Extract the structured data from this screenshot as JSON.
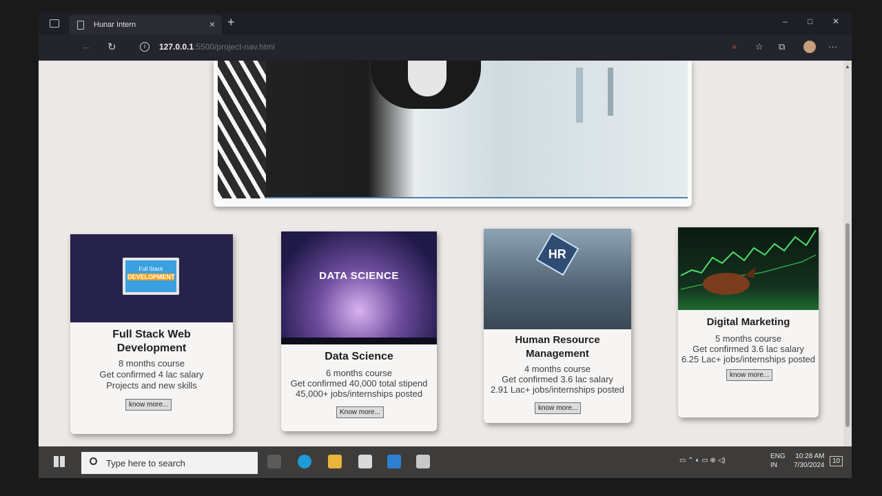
{
  "browser": {
    "tab_title": "Hunar Intern",
    "tab_close": "×",
    "new_tab": "+",
    "url_host": "127.0.0.1",
    "url_rest": ":5500/project-nav.html",
    "window_controls": [
      "–",
      "□",
      "✕"
    ]
  },
  "cards": [
    {
      "title": "Full Stack Web Development",
      "title_lines": [
        "Full Stack Web",
        "Development"
      ],
      "thumb_text_1": "Full Stack",
      "thumb_text_2": "DEVELOPMENT",
      "lines": [
        "8 months course",
        "Get confirmed 4 lac salary",
        "Projects and new skills"
      ],
      "button": "know more..."
    },
    {
      "title": "Data Science",
      "thumb_text": "DATA SCIENCE",
      "lines": [
        "6 months course",
        "Get confirmed 40,000 total stipend",
        "45,000+ jobs/internships posted"
      ],
      "button": "Know more..."
    },
    {
      "title": "Human Resource Management",
      "title_lines": [
        "Human Resource",
        "Management"
      ],
      "thumb_text": "HR",
      "lines": [
        "4 months course",
        "Get confirmed 3.6 lac salary",
        "2.91 Lac+ jobs/internships posted"
      ],
      "button": "know more..."
    },
    {
      "title": "Digital Marketing",
      "lines": [
        "5 months course",
        "Get confirmed 3.6 lac salary",
        "6.25 Lac+ jobs/internships posted"
      ],
      "button": "know more..."
    }
  ],
  "taskbar": {
    "search_placeholder": "Type here to search",
    "lang": "ENG",
    "region": "IN",
    "time": "10:28 AM",
    "date": "7/30/2024",
    "notifications": "10"
  }
}
